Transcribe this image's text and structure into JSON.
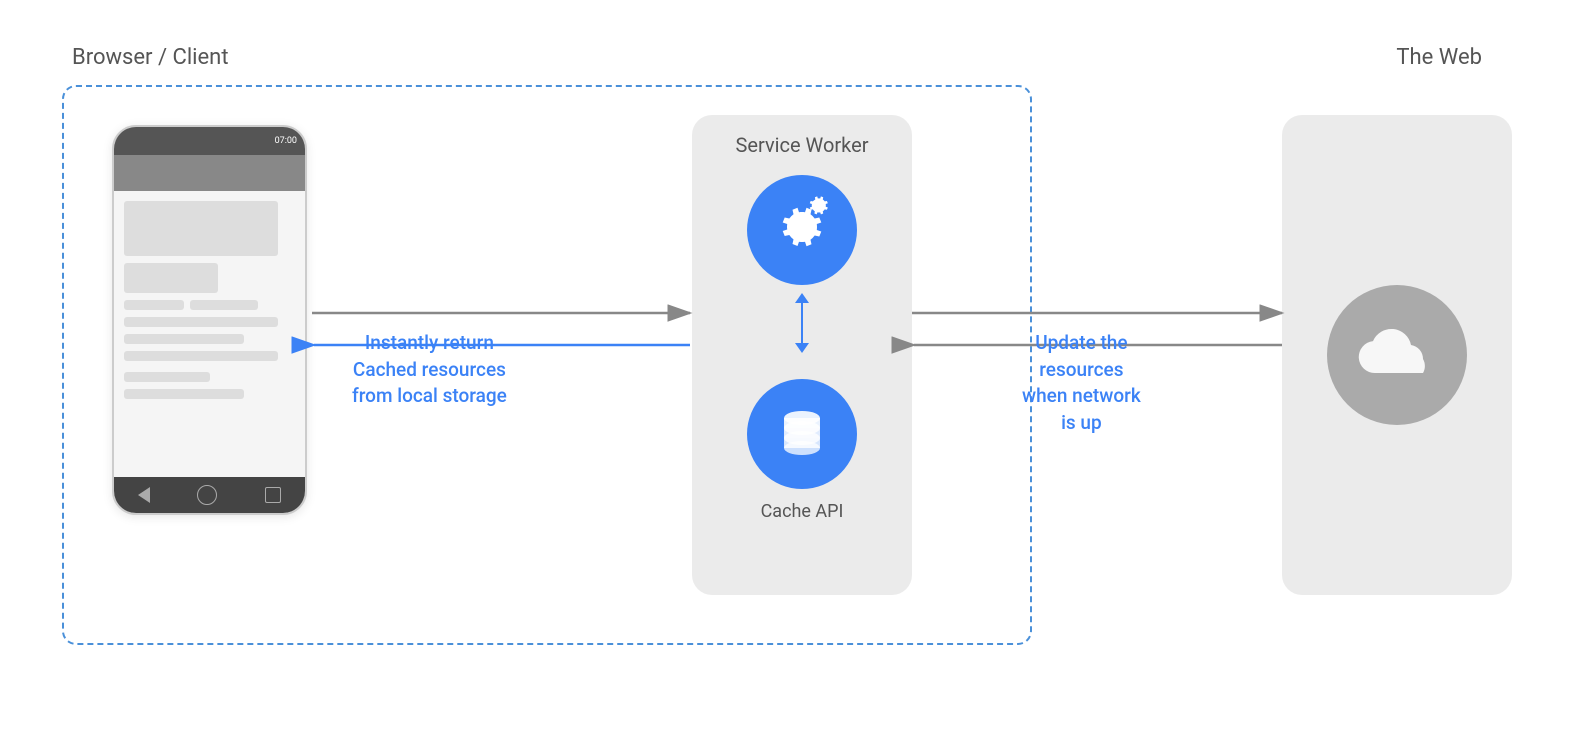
{
  "diagram": {
    "browser_label": "Browser / Client",
    "web_label": "The Web",
    "sw_label": "Service Worker",
    "cache_label": "Cache API",
    "instantly_return_line1": "Instantly return",
    "instantly_return_line2": "Cached resources",
    "instantly_return_line3": "from local storage",
    "update_line1": "Update the",
    "update_line2": "resources",
    "update_line3": "when network",
    "update_line4": "is up"
  },
  "colors": {
    "blue": "#3b82f6",
    "dashed_border": "#4A90D9",
    "text_label": "#555",
    "arrow_gray": "#888"
  }
}
